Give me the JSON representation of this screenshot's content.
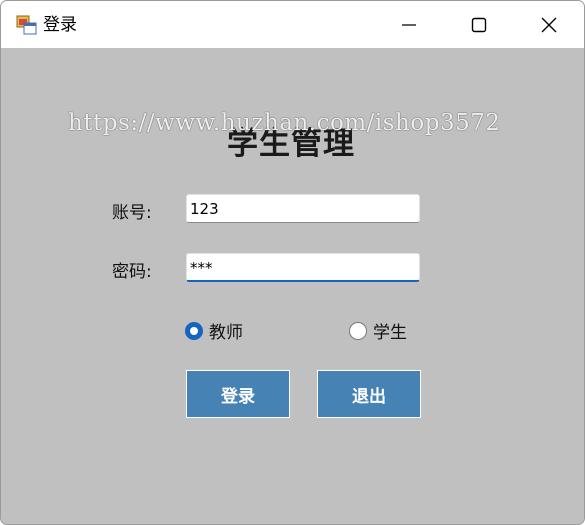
{
  "window": {
    "title": "登录",
    "icon": "form-app-icon",
    "controls": {
      "minimize": "minimize-icon",
      "maximize": "maximize-icon",
      "close": "close-icon"
    }
  },
  "form": {
    "heading": "学生管理",
    "watermark": "https://www.huzhan.com/ishop3572",
    "account_label": "账号:",
    "account_value": "123",
    "password_label": "密码:",
    "password_value": "***",
    "roles": [
      {
        "label": "教师",
        "selected": true
      },
      {
        "label": "学生",
        "selected": false
      }
    ],
    "login_label": "登录",
    "exit_label": "退出"
  },
  "colors": {
    "client_bg": "#c0c0c0",
    "button_bg": "#4682b4",
    "accent": "#1565c0"
  }
}
